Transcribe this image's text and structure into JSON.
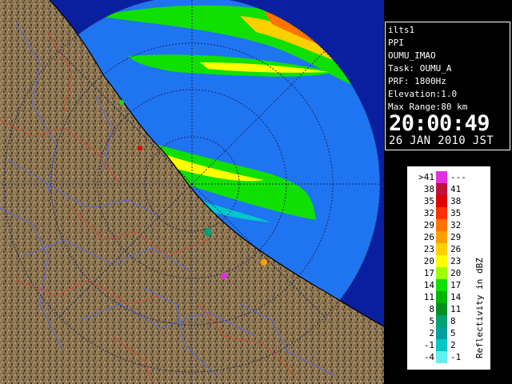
{
  "radar": {
    "site_id": "ilts1",
    "scan_type": "PPI",
    "volume_name": "OUMU_IMAO",
    "task": "Task: OUMU_A",
    "prf": "PRF: 1800Hz",
    "elevation": "Elevation:1.0",
    "max_range": "Max Range:80 km",
    "time": "20:00:49",
    "date": "26 JAN 2010 JST"
  },
  "colors": {
    "land": "#8a7352",
    "land_dark": "#4a3a24",
    "sea_coverage": "#1f74f2",
    "out_of_range": "#0a1fa0",
    "rivers": "#5a6be0",
    "boundaries": "#d04a3a",
    "range_rings": "#20306a"
  },
  "legend": {
    "unit_label": "Reflectivity in dBZ",
    "bins": [
      {
        "lo": ">41",
        "hi": "---",
        "color": "#e030e0"
      },
      {
        "lo": "38",
        "hi": "41",
        "color": "#c0103c"
      },
      {
        "lo": "35",
        "hi": "38",
        "color": "#e00000"
      },
      {
        "lo": "32",
        "hi": "35",
        "color": "#ff3000"
      },
      {
        "lo": "29",
        "hi": "32",
        "color": "#ff7400"
      },
      {
        "lo": "26",
        "hi": "29",
        "color": "#ffa000"
      },
      {
        "lo": "23",
        "hi": "26",
        "color": "#ffd000"
      },
      {
        "lo": "20",
        "hi": "23",
        "color": "#ffff00"
      },
      {
        "lo": "17",
        "hi": "20",
        "color": "#a0ff00"
      },
      {
        "lo": "14",
        "hi": "17",
        "color": "#10e000"
      },
      {
        "lo": "11",
        "hi": "14",
        "color": "#00b400"
      },
      {
        "lo": "8",
        "hi": "11",
        "color": "#009020"
      },
      {
        "lo": "5",
        "hi": "8",
        "color": "#00a070"
      },
      {
        "lo": "2",
        "hi": "5",
        "color": "#00a0a0"
      },
      {
        "lo": "-1",
        "hi": "2",
        "color": "#00c8c8"
      },
      {
        "lo": "-4",
        "hi": "-1",
        "color": "#60f0f0"
      }
    ]
  }
}
